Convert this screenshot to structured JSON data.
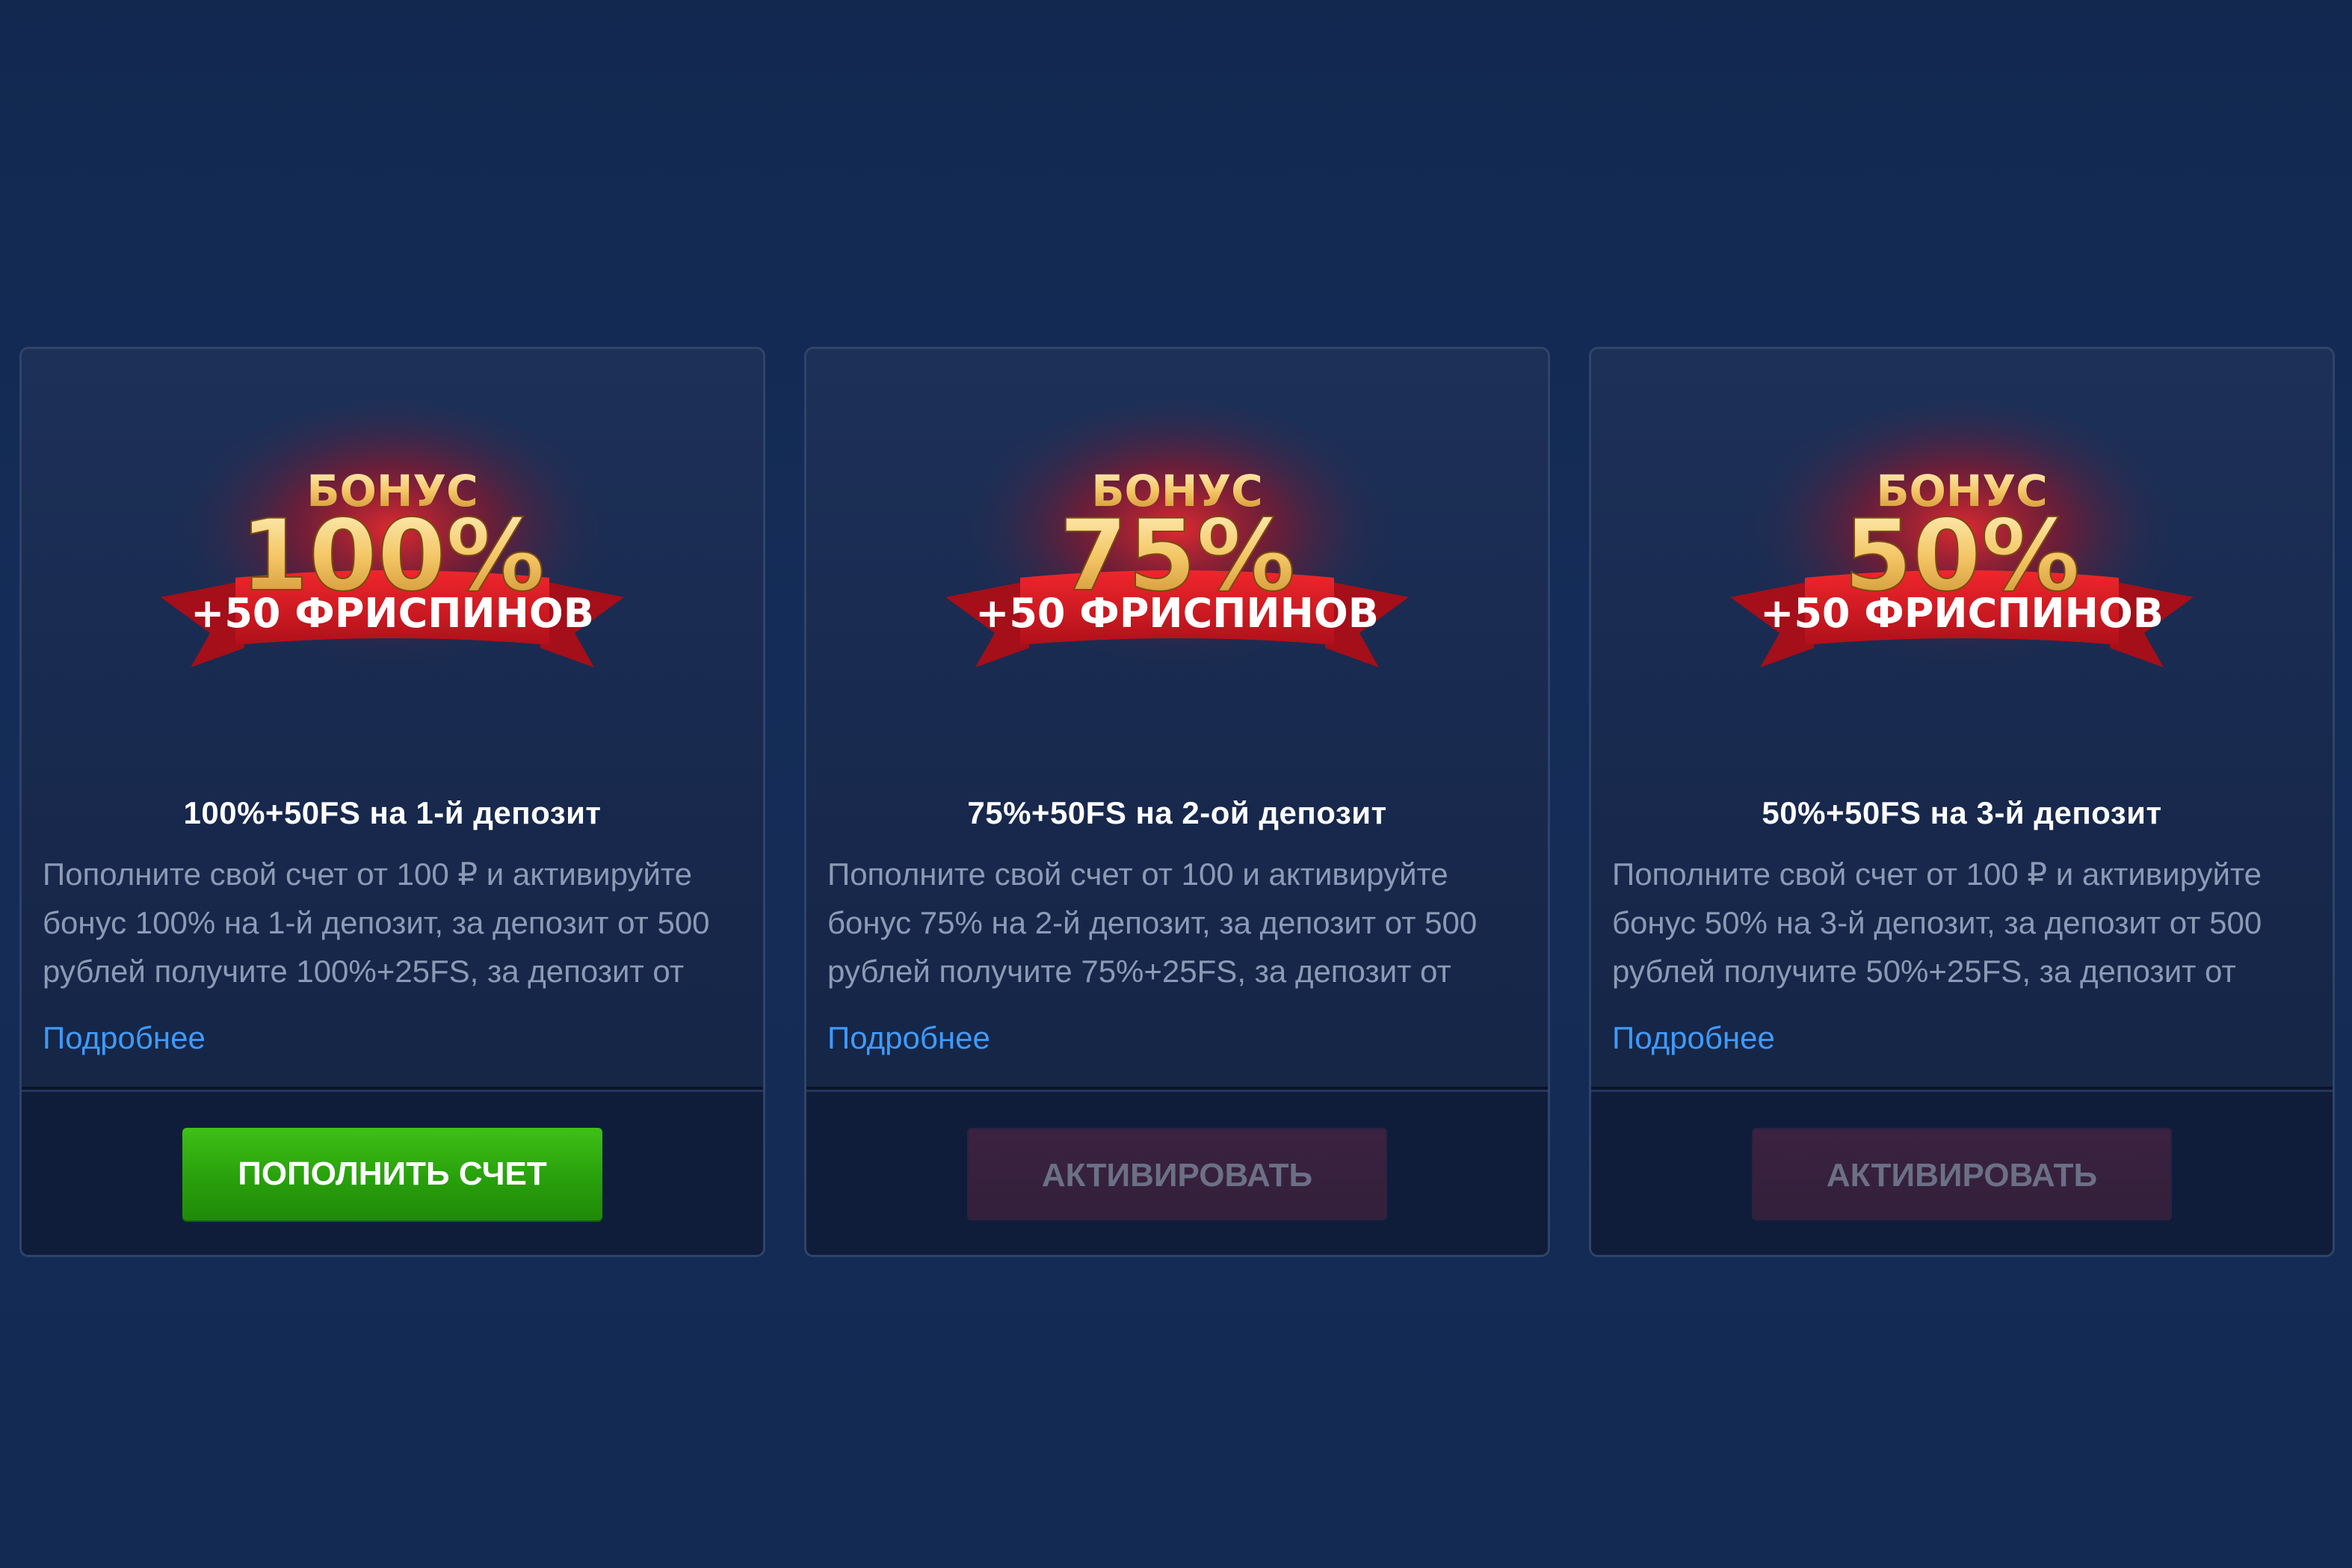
{
  "colors": {
    "background": "#132a52",
    "card_border": "#2f4468",
    "link": "#3d9bff",
    "deposit_button": "#28a00c",
    "activate_button": "#33203b",
    "ribbon_red": "#d9161c",
    "gold_text": "#f4c766"
  },
  "cards": [
    {
      "banner": {
        "heading": "БОНУС",
        "percent": "100%",
        "ribbon": "+50 ФРИСПИНОВ"
      },
      "title": "100%+50FS на 1-й депозит",
      "description": "Пополните свой счет от 100 ₽ и активируйте бонус 100% на 1-й депозит, за депозит от 500 рублей получите 100%+25FS, за депозит от",
      "more_link": "Подробнее",
      "button": "ПОПОЛНИТЬ СЧЕТ"
    },
    {
      "banner": {
        "heading": "БОНУС",
        "percent": "75%",
        "ribbon": "+50 ФРИСПИНОВ"
      },
      "title": "75%+50FS на 2-ой депозит",
      "description": "Пополните свой счет от 100 и активируйте бонус 75% на 2-й депозит, за депозит от 500 рублей получите 75%+25FS, за депозит от",
      "more_link": "Подробнее",
      "button": "АКТИВИРОВАТЬ"
    },
    {
      "banner": {
        "heading": "БОНУС",
        "percent": "50%",
        "ribbon": "+50 ФРИСПИНОВ"
      },
      "title": "50%+50FS на 3-й депозит",
      "description": "Пополните свой счет от 100 ₽ и активируйте бонус 50% на 3-й депозит, за депозит от 500 рублей получите 50%+25FS, за депозит от",
      "more_link": "Подробнее",
      "button": "АКТИВИРОВАТЬ"
    }
  ]
}
